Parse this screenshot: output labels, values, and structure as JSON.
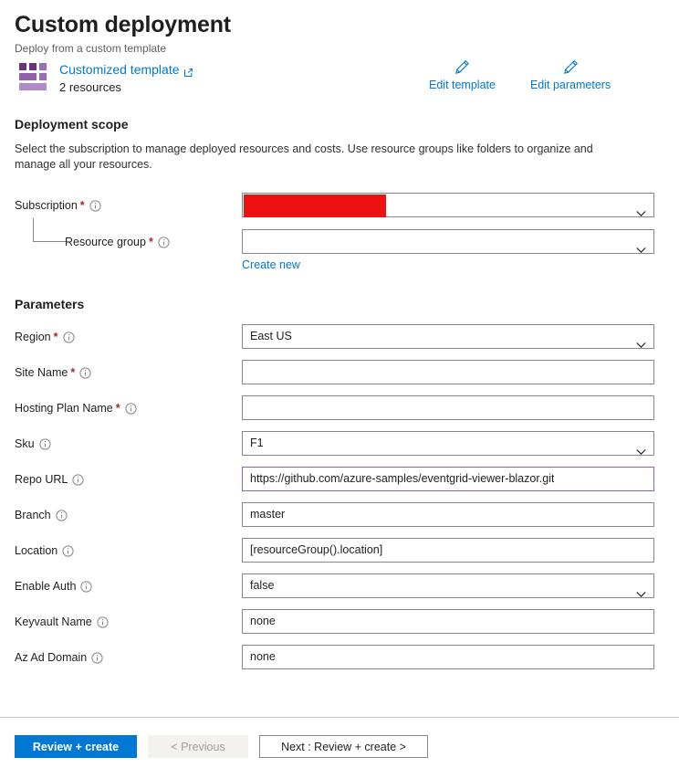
{
  "header": {
    "title": "Custom deployment",
    "subtitle": "Deploy from a custom template",
    "template_link": "Customized template",
    "template_resources": "2 resources",
    "edit_template": "Edit template",
    "edit_parameters": "Edit parameters"
  },
  "scope": {
    "heading": "Deployment scope",
    "description": "Select the subscription to manage deployed resources and costs. Use resource groups like folders to organize and manage all your resources.",
    "subscription_label": "Subscription",
    "subscription_value": "",
    "resource_group_label": "Resource group",
    "resource_group_value": "",
    "create_new": "Create new"
  },
  "parameters": {
    "heading": "Parameters",
    "fields": [
      {
        "label": "Region",
        "required": true,
        "value": "East US",
        "type": "select"
      },
      {
        "label": "Site Name",
        "required": true,
        "value": "",
        "type": "text"
      },
      {
        "label": "Hosting Plan Name",
        "required": true,
        "value": "",
        "type": "text"
      },
      {
        "label": "Sku",
        "required": false,
        "value": "F1",
        "type": "select"
      },
      {
        "label": "Repo URL",
        "required": false,
        "value": "https://github.com/azure-samples/eventgrid-viewer-blazor.git",
        "type": "text",
        "focused": true
      },
      {
        "label": "Branch",
        "required": false,
        "value": "master",
        "type": "text"
      },
      {
        "label": "Location",
        "required": false,
        "value": "[resourceGroup().location]",
        "type": "text"
      },
      {
        "label": "Enable Auth",
        "required": false,
        "value": "false",
        "type": "select"
      },
      {
        "label": "Keyvault Name",
        "required": false,
        "value": "none",
        "type": "text"
      },
      {
        "label": "Az Ad Domain",
        "required": false,
        "value": "none",
        "type": "text"
      }
    ]
  },
  "footer": {
    "review_create": "Review + create",
    "previous": "< Previous",
    "next": "Next : Review + create >"
  },
  "colors": {
    "accent": "#0078d4",
    "required": "#a4262c",
    "redaction": "#ee1111",
    "focus_border": "#8764b8",
    "template_purple": "#68347e"
  }
}
